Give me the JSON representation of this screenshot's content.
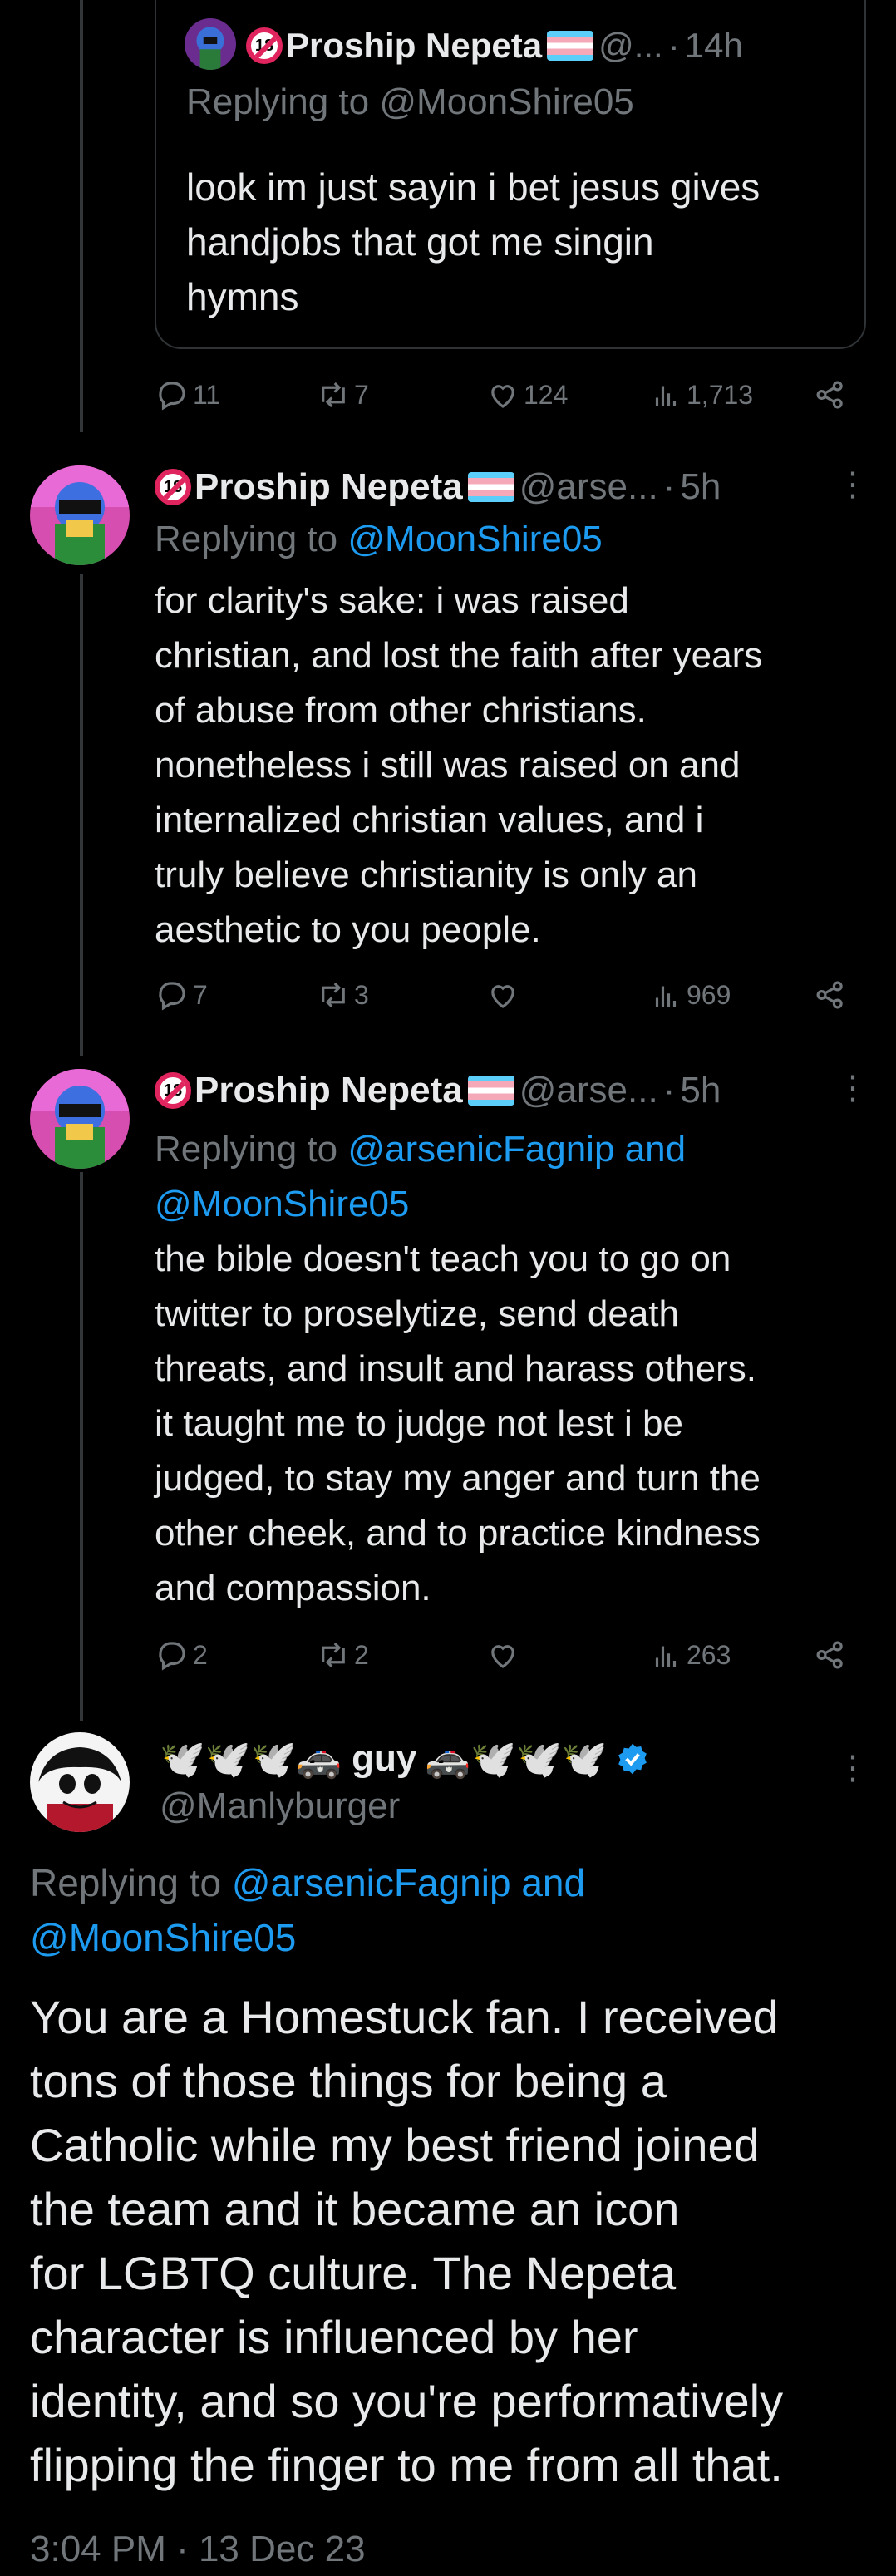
{
  "tweets": [
    {
      "display_name": "Proship Nepeta",
      "handle": "@...",
      "time": "14h",
      "replying_label": "Replying to",
      "replying_to": "@MoonShire05",
      "text_lines": [
        "look im just sayin i bet jesus gives",
        "handjobs that got me singin",
        "hymns"
      ],
      "stats": {
        "replies": "11",
        "retweets": "7",
        "likes": "124",
        "views": "1,713"
      }
    },
    {
      "display_name": "Proship Nepeta",
      "handle": "@arse...",
      "time": "5h",
      "replying_label": "Replying to",
      "replying_to": "@MoonShire05",
      "text_lines": [
        "for clarity's sake: i was raised",
        "christian, and lost the faith after years",
        "of abuse from other christians.",
        "nonetheless i still was raised on and",
        "internalized christian values, and i",
        "truly believe christianity is only an",
        "aesthetic to you people."
      ],
      "stats": {
        "replies": "7",
        "retweets": "3",
        "likes": "",
        "views": "969"
      }
    },
    {
      "display_name": "Proship Nepeta",
      "handle": "@arse...",
      "time": "5h",
      "replying_label": "Replying to",
      "replying_to_line1": "@arsenicFagnip and",
      "replying_to_line2": "@MoonShire05",
      "text_lines": [
        "the bible doesn't teach you to go on",
        "twitter to proselytize, send death",
        "threats, and insult and harass others.",
        "it taught me to judge not lest i be",
        "judged, to stay my anger and turn the",
        "other cheek, and to practice kindness",
        "and compassion."
      ],
      "stats": {
        "replies": "2",
        "retweets": "2",
        "likes": "",
        "views": "263"
      }
    }
  ],
  "main_tweet": {
    "display_name_left": "🕊️🕊️🕊️🚓",
    "display_name_mid": "guy",
    "display_name_right": "🚓🕊️🕊️🕊️",
    "handle": "@Manlyburger",
    "replying_label": "Replying to",
    "replying_to_line1": "@arsenicFagnip and",
    "replying_to_line2": "@MoonShire05",
    "text_lines": [
      "You are a Homestuck fan. I received",
      "tons of those things for being a",
      "Catholic while my best friend joined",
      "the team and it became an icon",
      "for LGBTQ culture. The Nepeta",
      "character is influenced by her",
      "identity, and so you're performatively",
      "flipping the finger to me from all that."
    ],
    "timestamp": "3:04 PM · 13 Dec 23"
  },
  "icons": {
    "reply": "reply-icon",
    "retweet": "retweet-icon",
    "like": "heart-icon",
    "views": "views-icon",
    "share": "share-icon",
    "more": "more-icon",
    "verified": "verified-badge-icon",
    "ban": "no-under-18-icon",
    "flag": "trans-flag-icon"
  },
  "colors": {
    "background": "#000000",
    "text": "#e7e9ea",
    "muted": "#71767b",
    "link": "#1d9bf0"
  }
}
